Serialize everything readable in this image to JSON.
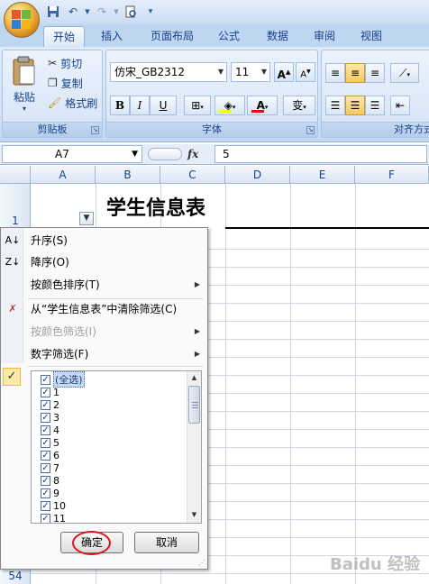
{
  "qat": {
    "icons": [
      "save-icon",
      "undo-icon",
      "redo-icon",
      "print-preview-icon",
      "customize-icon"
    ]
  },
  "tabs": [
    {
      "label": "开始",
      "active": true
    },
    {
      "label": "插入"
    },
    {
      "label": "页面布局"
    },
    {
      "label": "公式"
    },
    {
      "label": "数据"
    },
    {
      "label": "审阅"
    },
    {
      "label": "视图"
    }
  ],
  "clipboard": {
    "paste": "粘贴",
    "cut": "剪切",
    "copy": "复制",
    "format_painter": "格式刷",
    "group_label": "剪贴板"
  },
  "font": {
    "name": "仿宋_GB2312",
    "size": "11",
    "bold": "B",
    "italic": "I",
    "underline": "U",
    "wen": "变",
    "group_label": "字体"
  },
  "alignment": {
    "group_label": "对齐方式"
  },
  "formula_bar": {
    "cell_ref": "A7",
    "fx": "fx",
    "value": "5"
  },
  "columns": [
    "A",
    "B",
    "C",
    "D",
    "E",
    "F"
  ],
  "rows": {
    "first": "1",
    "last": "54"
  },
  "sheet": {
    "title": "学生信息表"
  },
  "menu": {
    "sort_asc": "升序(S)",
    "sort_desc": "降序(O)",
    "sort_color": "按颜色排序(T)",
    "clear_filter": "从“学生信息表”中清除筛选(C)",
    "filter_color": "按颜色筛选(I)",
    "number_filter": "数字筛选(F)"
  },
  "filter_list": [
    "(全选)",
    "1",
    "2",
    "3",
    "4",
    "5",
    "6",
    "7",
    "8",
    "9",
    "10",
    "11"
  ],
  "buttons": {
    "ok": "确定",
    "cancel": "取消"
  },
  "watermark": "Baidu 经验",
  "colors": {
    "accent_red": "#d9161c",
    "ribbon_blue": "#15428b"
  }
}
